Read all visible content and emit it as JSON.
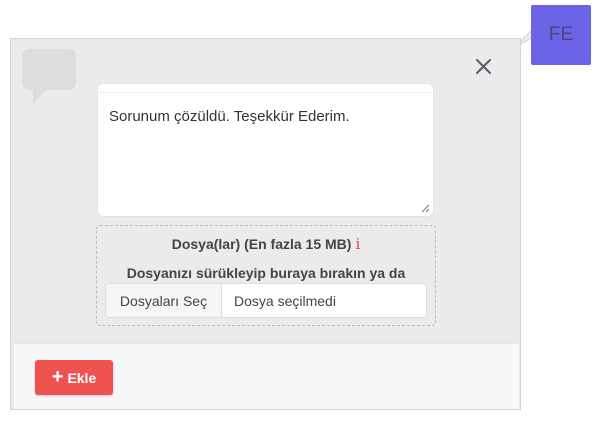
{
  "avatar": {
    "initials": "FE",
    "bg_color": "#6c63e6"
  },
  "panel": {
    "chat_icon": "chat-bubble-icon",
    "close_icon": "close-icon"
  },
  "message": {
    "text": "Sorunum çözüldü. Teşekkür Ederim."
  },
  "upload": {
    "title": "Dosya(lar) (En fazla 15 MB)",
    "info_glyph": "i",
    "info_color": "#e8433d",
    "drop_hint": "Dosyanızı sürükleyip buraya bırakın ya da",
    "choose_label": "Dosyaları Seç",
    "status": "Dosya seçilmedi"
  },
  "footer": {
    "add_label": "Ekle",
    "add_color": "#ef5350"
  }
}
